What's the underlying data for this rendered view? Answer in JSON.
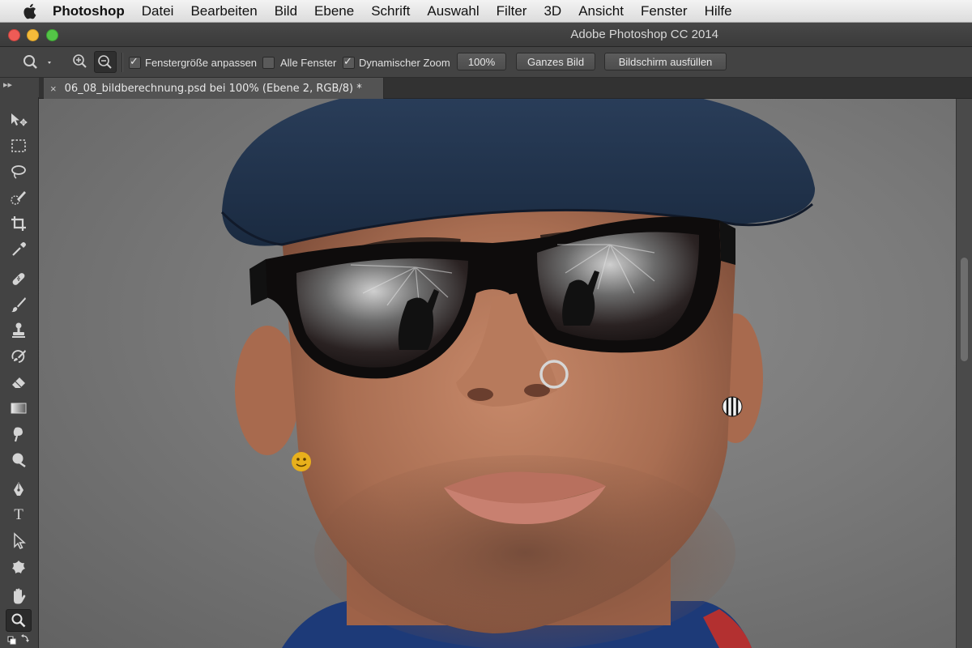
{
  "menubar": {
    "app": "Photoshop",
    "items": [
      "Datei",
      "Bearbeiten",
      "Bild",
      "Ebene",
      "Schrift",
      "Auswahl",
      "Filter",
      "3D",
      "Ansicht",
      "Fenster",
      "Hilfe"
    ]
  },
  "window": {
    "title": "Adobe Photoshop CC 2014"
  },
  "options": {
    "fit_window_label": "Fenstergröße anpassen",
    "fit_window_checked": true,
    "all_windows_label": "Alle Fenster",
    "all_windows_checked": false,
    "scrubby_zoom_label": "Dynamischer Zoom",
    "scrubby_zoom_checked": true,
    "zoom_100_label": "100%",
    "fit_screen_label": "Ganzes Bild",
    "fill_screen_label": "Bildschirm ausfüllen"
  },
  "document": {
    "tab_title": "06_08_bildberechnung.psd bei 100% (Ebene 2, RGB/8) *",
    "close_glyph": "×"
  },
  "tools": {
    "type_tool_glyph": "T",
    "active": "zoom-tool"
  },
  "colors": {
    "menubar": "#e6e6e6",
    "titlebar": "#434343",
    "panel": "#434343",
    "canvas_bg": "#7a7a7a",
    "close": "#ee5b56",
    "minimize": "#f5bb3a",
    "maximize": "#54c447"
  }
}
